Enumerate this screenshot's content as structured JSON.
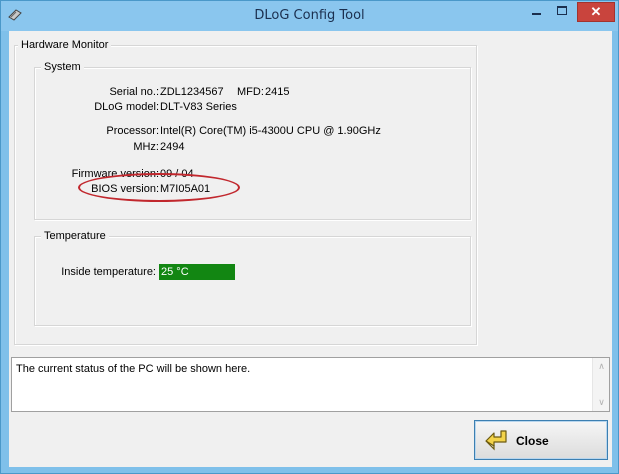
{
  "window": {
    "title": "DLoG Config Tool"
  },
  "hardware_monitor": {
    "legend": "Hardware Monitor",
    "system": {
      "legend": "System",
      "serial_label": "Serial no.:",
      "serial_value": "ZDL1234567",
      "mfd_label": "MFD:",
      "mfd_value": "2415",
      "model_label": "DLoG model:",
      "model_value": "DLT-V83 Series",
      "processor_label": "Processor:",
      "processor_value": "Intel(R) Core(TM) i5-4300U CPU @ 1.90GHz",
      "mhz_label": "MHz:",
      "mhz_value": "2494",
      "firmware_label": "Firmware version:",
      "firmware_value": "09 / 04",
      "bios_label": "BIOS version:",
      "bios_value": "M7I05A01"
    },
    "temperature": {
      "legend": "Temperature",
      "inside_label": "Inside temperature:",
      "inside_value": "25 °C"
    }
  },
  "status_box": {
    "text": "The current status of the PC will be shown here."
  },
  "close_button": {
    "label": "Close"
  },
  "colors": {
    "title_bar": "#8ac6ee",
    "close_x": "#c9443d",
    "temperature_ok": "#128612",
    "annotation": "#c1272d"
  }
}
